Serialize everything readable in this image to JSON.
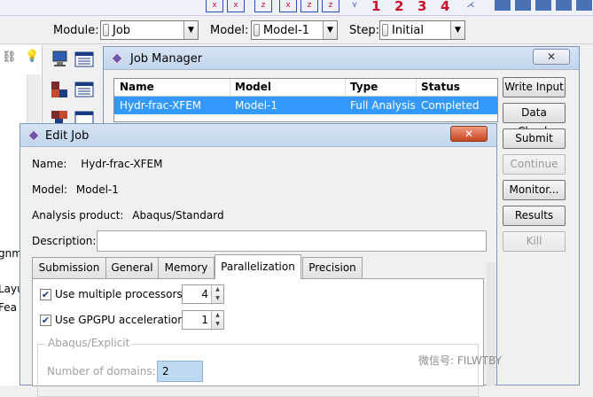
{
  "context_bar": {
    "module_label": "Module:",
    "module_value": "Job",
    "model_label": "Model:",
    "model_value": "Model-1",
    "step_label": "Step:",
    "step_value": "Initial"
  },
  "toolbar": {
    "numbers": [
      "1",
      "2",
      "3",
      "4"
    ]
  },
  "left_panel": {
    "fragments": [
      "gnm",
      "Layu",
      "Fea"
    ]
  },
  "job_manager": {
    "title": "Job Manager",
    "columns": [
      "Name",
      "Model",
      "Type",
      "Status"
    ],
    "rows": [
      {
        "name": "Hydr-frac-XFEM",
        "model": "Model-1",
        "type": "Full Analysis",
        "status": "Completed"
      }
    ],
    "buttons": {
      "write_input": "Write Input",
      "data_check": "Data Check",
      "submit": "Submit",
      "continue": "Continue",
      "monitor": "Monitor...",
      "results": "Results",
      "kill": "Kill"
    }
  },
  "edit_job": {
    "title": "Edit Job",
    "name_label": "Name:",
    "name_value": "Hydr-frac-XFEM",
    "model_label": "Model:",
    "model_value": "Model-1",
    "product_label": "Analysis product:",
    "product_value": "Abaqus/Standard",
    "description_label": "Description:",
    "description_value": "",
    "tabs": [
      "Submission",
      "General",
      "Memory",
      "Parallelization",
      "Precision"
    ],
    "active_tab": "Parallelization",
    "multiple_processors_label": "Use multiple processors",
    "multiple_processors_checked": true,
    "processors": "4",
    "gpgpu_label": "Use GPGPU acceleration",
    "gpgpu_checked": true,
    "gpgpu_count": "1",
    "explicit_group_label": "Abaqus/Explicit",
    "domains_label": "Number of domains:",
    "domains_value": "2"
  },
  "watermark": "微信号: FILWTBY"
}
